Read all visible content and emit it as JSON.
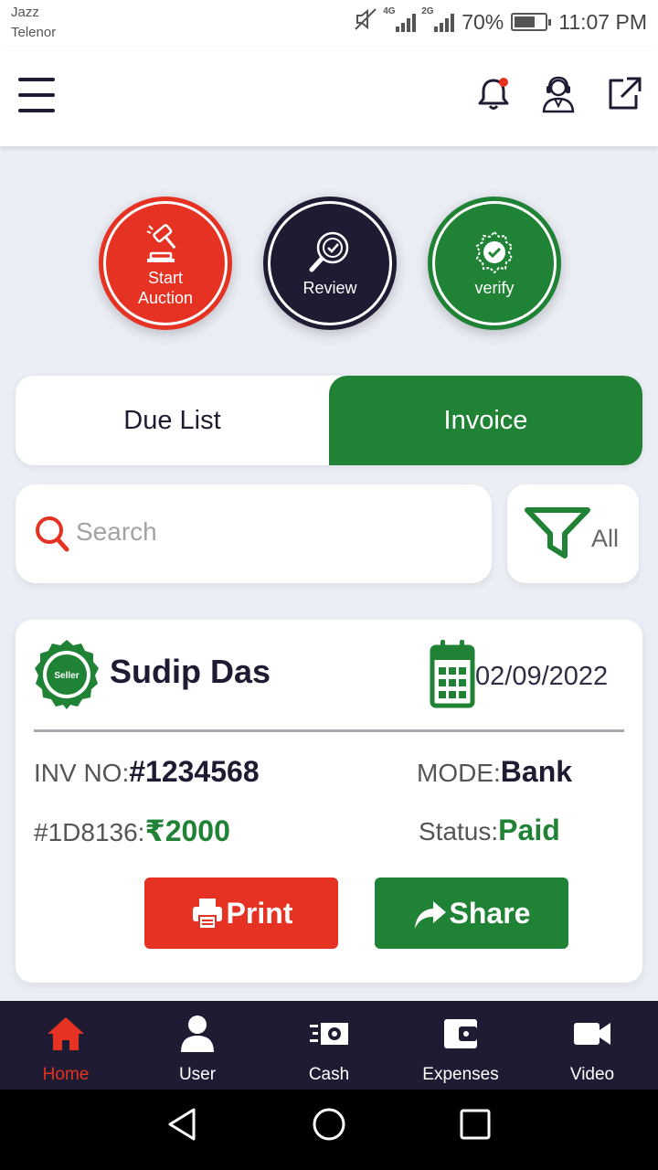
{
  "status_bar": {
    "carrier_1": "Jazz",
    "carrier_2": "Telenor",
    "network_1": "4G",
    "network_2": "2G",
    "battery": "70%",
    "battery_level": 0.7,
    "time": "11:07 PM"
  },
  "header": {
    "icons": [
      "menu-icon",
      "bell-icon",
      "support-agent-icon",
      "external-link-icon"
    ],
    "notification_dot": true
  },
  "actions": [
    {
      "label_1": "Start",
      "label_2": "Auction",
      "icon": "gavel-icon",
      "color": "#e53222"
    },
    {
      "label": "Review",
      "icon": "magnify-check-icon",
      "color": "#1e1b33"
    },
    {
      "label": "verify",
      "icon": "verified-badge-icon",
      "color": "#1f8235"
    }
  ],
  "tabs": [
    {
      "label": "Due List",
      "active": false
    },
    {
      "label": "Invoice",
      "active": true
    }
  ],
  "search": {
    "placeholder": "Search"
  },
  "filter": {
    "label": "All"
  },
  "invoice": {
    "badge_text": "Seller",
    "seller_name": "Sudip Das",
    "date": "02/09/2022",
    "inv_no_label": "INV NO:",
    "inv_no": "#1234568",
    "mode_label": "MODE:",
    "mode": "Bank",
    "id_label": "#1D8136:",
    "amount": "₹2000",
    "status_label": "Status:",
    "status": "Paid",
    "print_label": "Print",
    "share_label": "Share"
  },
  "bottom_nav": [
    {
      "label": "Home",
      "icon": "home-icon",
      "active": true
    },
    {
      "label": "User",
      "icon": "user-icon",
      "active": false
    },
    {
      "label": "Cash",
      "icon": "cash-icon",
      "active": false
    },
    {
      "label": "Expenses",
      "icon": "wallet-icon",
      "active": false
    },
    {
      "label": "Video",
      "icon": "video-camera-icon",
      "active": false
    }
  ],
  "colors": {
    "brand_dark": "#1e1b33",
    "accent_red": "#e53222",
    "accent_green": "#1f8235",
    "background": "#eceef6"
  }
}
